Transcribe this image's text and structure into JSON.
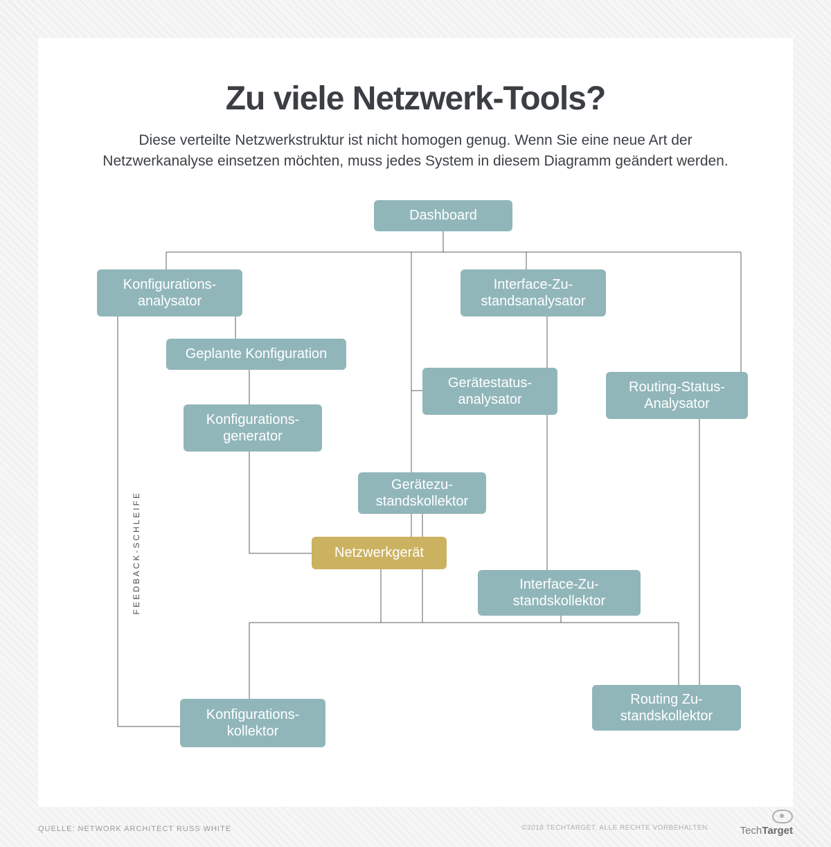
{
  "title": "Zu viele Netzwerk-Tools?",
  "subtitle": "Diese verteilte Netzwerkstruktur ist nicht homogen genug. Wenn Sie eine neue Art der Netzwerkanalyse einsetzen möchten, muss jedes System in diesem Diagramm geändert werden.",
  "nodes": {
    "dashboard": "Dashboard",
    "konfig_analysator": "Konfigurations-\nanalysator",
    "interface_analysator": "Interface-Zu-\nstandsanalysator",
    "geplante_konfig": "Geplante Konfiguration",
    "geraetestatus_analysator": "Gerätestatus-\nanalysator",
    "routing_status_analysator": "Routing-Status-\nAnalysator",
    "konfig_generator": "Konfigurations-\ngenerator",
    "geraetezustand_kollektor": "Gerätezu-\nstandskollektor",
    "netzwerkgeraet": "Netzwerkgerät",
    "interface_kollektor": "Interface-Zu-\nstandskollektor",
    "konfig_kollektor": "Konfigurations-\nkollektor",
    "routing_kollektor": "Routing Zu-\nstandskollektor"
  },
  "feedback_label": "FEEDBACK-SCHLEIFE",
  "source": "QUELLE: NETWORK ARCHITECT RUSS WHITE",
  "copyright": "©2018 TECHTARGET. ALLE RECHTE VORBEHALTEN.",
  "logo": {
    "a": "Tech",
    "b": "Target"
  }
}
